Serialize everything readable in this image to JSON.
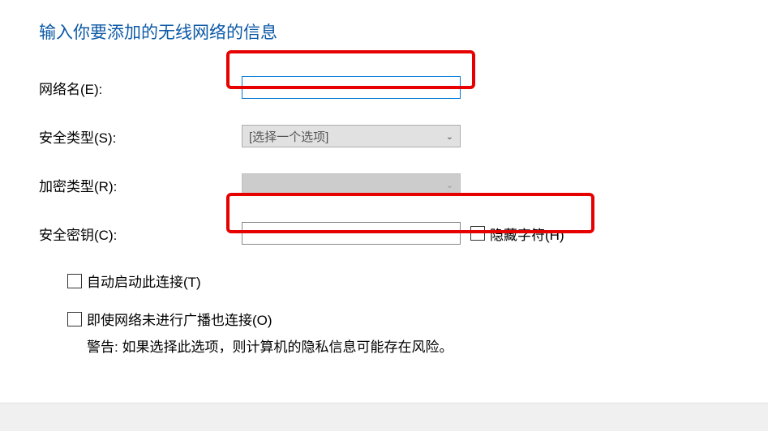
{
  "title": "输入你要添加的无线网络的信息",
  "fields": {
    "network_name": {
      "label": "网络名(E):",
      "value": ""
    },
    "security_type": {
      "label": "安全类型(S):",
      "selected": "[选择一个选项]"
    },
    "encryption_type": {
      "label": "加密类型(R):",
      "selected": ""
    },
    "security_key": {
      "label": "安全密钥(C):",
      "value": ""
    }
  },
  "hide_chars": {
    "label": "隐藏字符(H)"
  },
  "options": {
    "auto_start": {
      "label": "自动启动此连接(T)"
    },
    "connect_no_broadcast": {
      "label": "即使网络未进行广播也连接(O)",
      "warning": "警告: 如果选择此选项，则计算机的隐私信息可能存在风险。"
    }
  }
}
